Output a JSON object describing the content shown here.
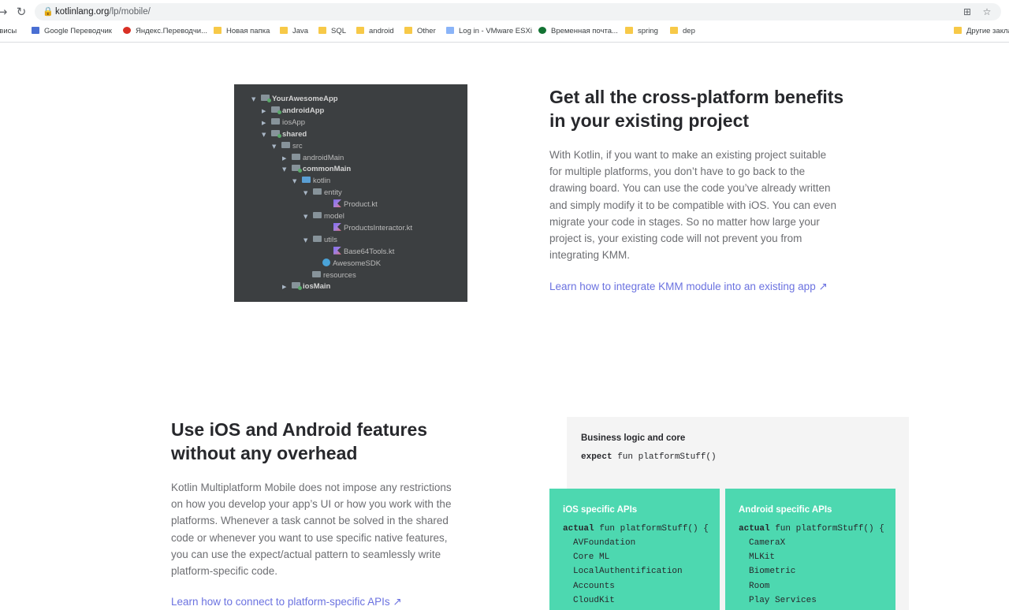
{
  "browser": {
    "url_host": "kotlinlang.org",
    "url_path": "/lp/mobile/",
    "bookmarks": [
      {
        "label": "рвисы",
        "icon": "apps-icon"
      },
      {
        "label": "Google Переводчик",
        "icon": "google-translate-icon"
      },
      {
        "label": "Яндекс.Переводчи...",
        "icon": "yandex-icon"
      },
      {
        "label": "Новая папка",
        "icon": "folder-icon"
      },
      {
        "label": "Java",
        "icon": "folder-icon"
      },
      {
        "label": "SQL",
        "icon": "folder-icon"
      },
      {
        "label": "android",
        "icon": "folder-icon"
      },
      {
        "label": "Other",
        "icon": "folder-icon"
      },
      {
        "label": "Log in - VMware ESXi",
        "icon": "vmware-icon"
      },
      {
        "label": "Временная почта...",
        "icon": "tempmail-icon"
      },
      {
        "label": "spring",
        "icon": "folder-icon"
      },
      {
        "label": "dep",
        "icon": "folder-icon"
      },
      {
        "label": "Другие закла",
        "icon": "folder-icon"
      }
    ]
  },
  "tree": [
    {
      "label": "YourAwesomeApp",
      "arrow": "▼",
      "icon": "mod",
      "bold": true
    },
    {
      "label": "androidApp",
      "arrow": "▶",
      "icon": "mod",
      "bold": true
    },
    {
      "label": "iosApp",
      "arrow": "▶",
      "icon": "plain",
      "bold": false
    },
    {
      "label": "shared",
      "arrow": "▼",
      "icon": "mod",
      "bold": true
    },
    {
      "label": "src",
      "arrow": "▼",
      "icon": "plain",
      "bold": false
    },
    {
      "label": "androidMain",
      "arrow": "▶",
      "icon": "plain",
      "bold": false
    },
    {
      "label": "commonMain",
      "arrow": "▼",
      "icon": "mod",
      "bold": true
    },
    {
      "label": "kotlin",
      "arrow": "▼",
      "icon": "blue",
      "bold": false
    },
    {
      "label": "entity",
      "arrow": "▼",
      "icon": "plain",
      "bold": false
    },
    {
      "label": "Product.kt",
      "arrow": "",
      "icon": "kt",
      "bold": false
    },
    {
      "label": "model",
      "arrow": "▼",
      "icon": "plain",
      "bold": false
    },
    {
      "label": "ProductsInteractor.kt",
      "arrow": "",
      "icon": "kt",
      "bold": false
    },
    {
      "label": "utils",
      "arrow": "▼",
      "icon": "plain",
      "bold": false
    },
    {
      "label": "Base64Tools.kt",
      "arrow": "",
      "icon": "kt",
      "bold": false
    },
    {
      "label": "AwesomeSDK",
      "arrow": "",
      "icon": "sdk",
      "bold": false
    },
    {
      "label": "resources",
      "arrow": "",
      "icon": "plain",
      "bold": false
    },
    {
      "label": "iosMain",
      "arrow": "▶",
      "icon": "mod",
      "bold": true
    }
  ],
  "section1": {
    "title_line1": "Get all the cross-platform benefits",
    "title_line2": "in your existing project",
    "body": "With Kotlin, if you want to make an existing project suitable for multiple platforms, you don’t have to go back to the drawing board. You can use the code you’ve already written and simply modify it to be compatible with iOS. You can even migrate your code in stages. So no matter how large your project is, your existing code will not prevent you from integrating KMM.",
    "link": "Learn how to integrate KMM module into an existing app ↗"
  },
  "section2": {
    "title_line1": "Use iOS and Android features",
    "title_line2": "without any overhead",
    "body": "Kotlin Multiplatform Mobile does not impose any restrictions on how you develop your app’s UI or how you work with the platforms. Whenever a task cannot be solved in the shared code or whenever you want to use specific native features, you can use the expect/actual pattern to seamlessly write platform-specific code.",
    "link": "Learn how to connect to platform-specific APIs ↗"
  },
  "code": {
    "business_title": "Business logic and core",
    "expect_kw": "expect",
    "expect_rest": " fun platformStuff()",
    "ios_title": "iOS specific APIs",
    "android_title": "Android specific APIs",
    "actual_kw": "actual",
    "actual_rest": " fun platformStuff() {",
    "ios_apis": [
      "AVFoundation",
      "Core ML",
      "LocalAuthentification",
      "Accounts",
      "CloudKit"
    ],
    "android_apis": [
      "CameraX",
      "MLKit",
      "Biometric",
      "Room",
      "Play Services"
    ]
  }
}
